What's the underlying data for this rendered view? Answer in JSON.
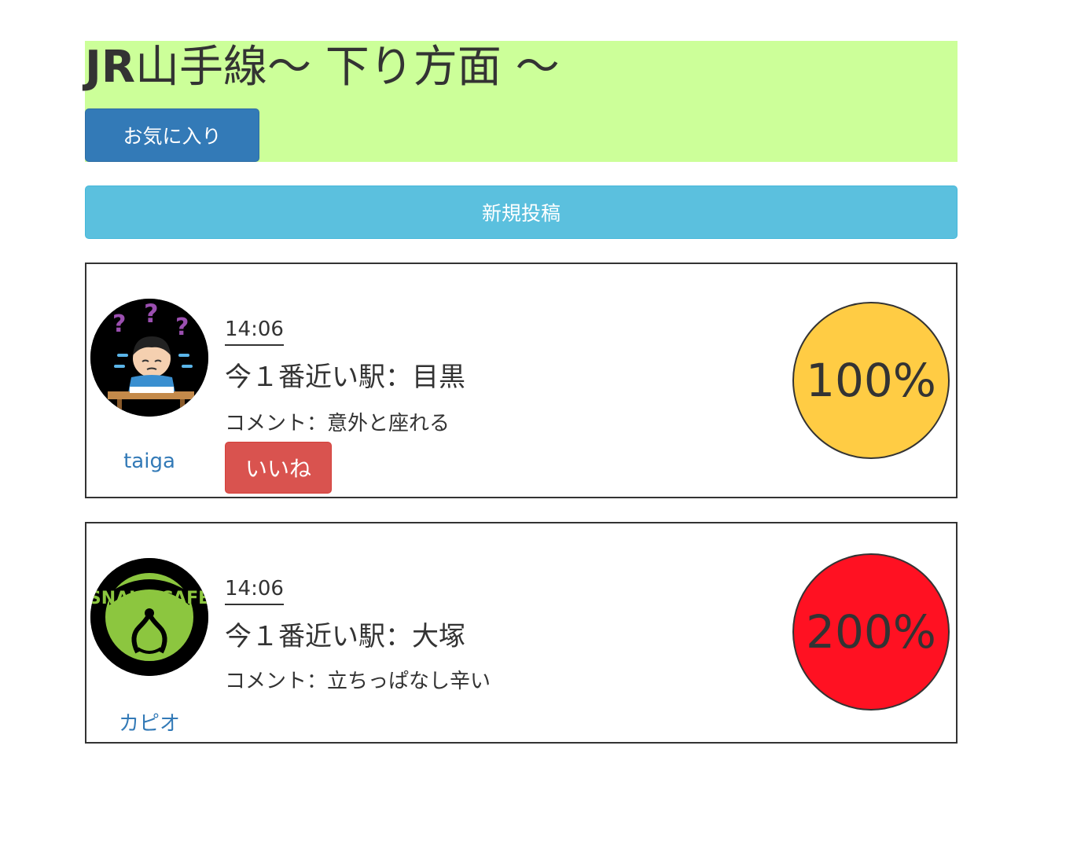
{
  "header": {
    "title_brand": "JR",
    "title_rest": "山手線〜 下り方面 〜",
    "favorite_label": "お気に入り",
    "background_color": "#ccff99"
  },
  "new_post_label": "新規投稿",
  "posts": [
    {
      "user": "taiga",
      "avatar_icon": "confused-student-avatar",
      "time": "14:06",
      "station": "今１番近い駅：目黒",
      "comment": "コメント：意外と座れる",
      "like_label": "いいね",
      "congestion": "100%",
      "congestion_color": "#ffcc44"
    },
    {
      "user": "カピオ",
      "avatar_icon": "snake-cafe-logo-avatar",
      "avatar_logo_text": "SNAKE CAFE",
      "time": "14:06",
      "station": "今１番近い駅：大塚",
      "comment": "コメント：立ちっぱなし辛い",
      "congestion": "200%",
      "congestion_color": "#ff1122"
    }
  ]
}
